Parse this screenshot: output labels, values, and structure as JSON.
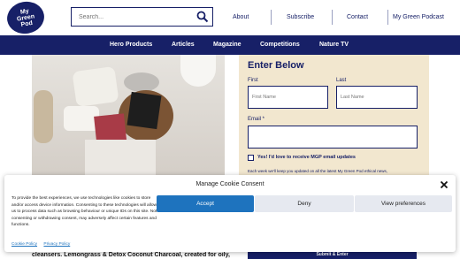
{
  "header": {
    "logo_lines": [
      "My",
      "Green",
      "Pod"
    ],
    "search": {
      "placeholder": "Search..."
    },
    "links": [
      "About",
      "Subscribe",
      "Contact",
      "My Green Podcast"
    ]
  },
  "nav": {
    "items": [
      "Hero Products",
      "Articles",
      "Magazine",
      "Competitions",
      "Nature TV"
    ]
  },
  "form": {
    "heading": "Enter Below",
    "first_label": "First",
    "first_placeholder": "First Name",
    "last_label": "Last",
    "last_placeholder": "Last Name",
    "email_label": "Email *",
    "checkbox_label": "Yes! I'd love to receive MGP email updates",
    "note": "Each week we'll keep you updated on all the latest My Green Pod ethical news,"
  },
  "background": {
    "body_text": "cleansers. Lemongrass & Detox Coconut Charcoal, created for oily,",
    "submit_label": "Submit & Enter"
  },
  "cookie": {
    "title": "Manage Cookie Consent",
    "description": "To provide the best experiences, we use technologies like cookies to store and/or access device information. Consenting to these technologies will allow us to process data such as browsing behaviour or unique IDs on this site. Not consenting or withdrawing consent, may adversely affect certain features and functions.",
    "accept": "Accept",
    "deny": "Deny",
    "preferences": "View preferences",
    "cookie_policy": "Cookie Policy",
    "privacy_policy": "Privacy Policy"
  },
  "colors": {
    "brand_navy": "#172067",
    "form_bg": "#f2e7cf",
    "accept_blue": "#1e73be"
  }
}
